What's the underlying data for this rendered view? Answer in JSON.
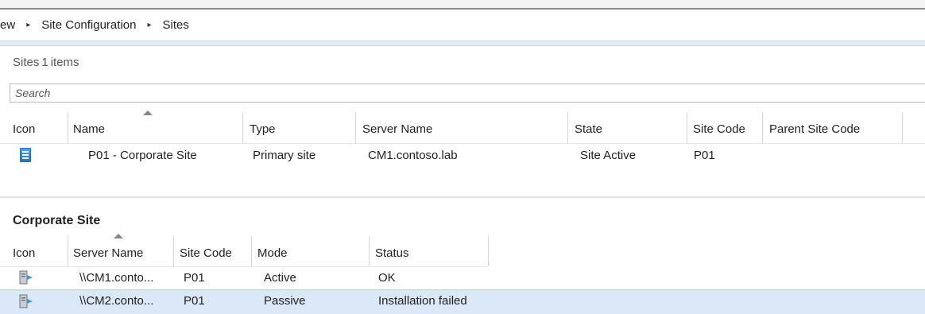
{
  "breadcrumb": {
    "items": [
      "ew",
      "Site Configuration",
      "Sites"
    ],
    "separator": "▸"
  },
  "sites_header": {
    "name": "Sites",
    "count": "1",
    "suffix": "items"
  },
  "search": {
    "placeholder": "Search",
    "value": ""
  },
  "sites_table": {
    "columns": [
      "Icon",
      "Name",
      "Type",
      "Server Name",
      "State",
      "Site Code",
      "Parent Site Code"
    ],
    "sorted_column": "Name",
    "rows": [
      {
        "icon": "site-icon",
        "name": "P01 - Corporate Site",
        "type": "Primary site",
        "server_name": "CM1.contoso.lab",
        "state": "Site Active",
        "site_code": "P01",
        "parent_site_code": ""
      }
    ]
  },
  "detail": {
    "title": "Corporate Site",
    "columns": [
      "Icon",
      "Server Name",
      "Site Code",
      "Mode",
      "Status"
    ],
    "sorted_column": "Server Name",
    "rows": [
      {
        "icon": "server-icon",
        "server_name": "\\\\CM1.conto...",
        "site_code": "P01",
        "mode": "Active",
        "status": "OK",
        "selected": false
      },
      {
        "icon": "server-icon",
        "server_name": "\\\\CM2.conto...",
        "site_code": "P01",
        "mode": "Passive",
        "status": "Installation failed",
        "selected": true
      }
    ]
  },
  "colors": {
    "selection": "#dbe8f7",
    "site_icon": "#2a6fc0"
  }
}
